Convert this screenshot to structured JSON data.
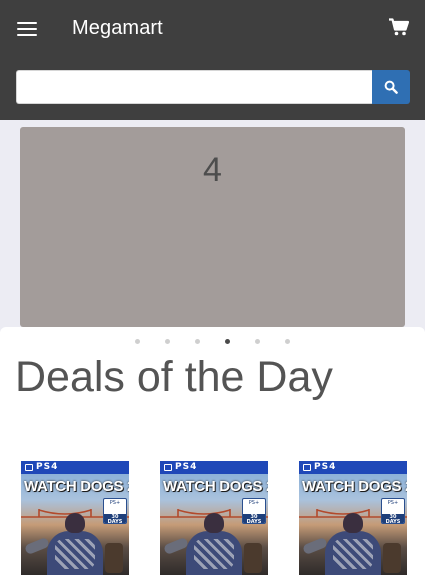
{
  "header": {
    "title": "Megamart",
    "menu_icon": "hamburger-menu-icon",
    "cart_icon": "shopping-cart-icon"
  },
  "search": {
    "value": "",
    "placeholder": "",
    "button_icon": "search-icon"
  },
  "carousel": {
    "current_slide_label": "4",
    "slide_count": 6,
    "active_index": 3
  },
  "deals": {
    "heading": "Deals of the Day",
    "products": [
      {
        "platform": "PS4",
        "title": "WATCH DOGS 2",
        "badge_days": "30 DAYS"
      },
      {
        "platform": "PS4",
        "title": "WATCH DOGS 2",
        "badge_days": "30 DAYS"
      },
      {
        "platform": "PS4",
        "title": "WATCH DOGS 2",
        "badge_days": "30 DAYS"
      }
    ]
  },
  "colors": {
    "topbar": "#3f3f3f",
    "search_button": "#2f6fb3",
    "slide_background": "#a39c9a",
    "page_background": "#ececf3"
  }
}
